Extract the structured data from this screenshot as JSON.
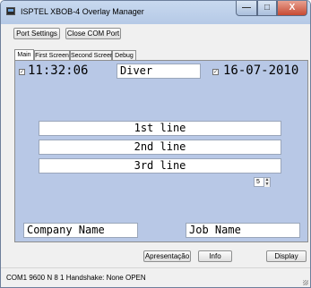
{
  "window": {
    "title": "ISPTEL XBOB-4 Overlay Manager",
    "controls": {
      "minimize": "—",
      "maximize": "□",
      "close": "X"
    }
  },
  "toolbar": {
    "port_settings_label": "Port Settings",
    "close_com_label": "Close COM Port"
  },
  "tabs": [
    {
      "label": "Main"
    },
    {
      "label": "First Screen"
    },
    {
      "label": "Second Screen"
    },
    {
      "label": "Debug"
    }
  ],
  "main": {
    "time_checked": "✓",
    "time": "11:32:06",
    "diver": "Diver",
    "date_checked": "✓",
    "date": "16-07-2010",
    "lines": [
      "1st line",
      "2nd line",
      "3rd line"
    ],
    "spinner_value": "5",
    "company_name": "Company Name",
    "job_name": "Job Name"
  },
  "actions": {
    "apresentacao_label": "Apresentação",
    "info_label": "Info",
    "display_label": "Display"
  },
  "status": {
    "text": "COM1   9600   N 8 1   Handshake: None   OPEN"
  },
  "colors": {
    "panel_bg": "#b8c8e6",
    "titlebar": "#c8d9ef"
  }
}
